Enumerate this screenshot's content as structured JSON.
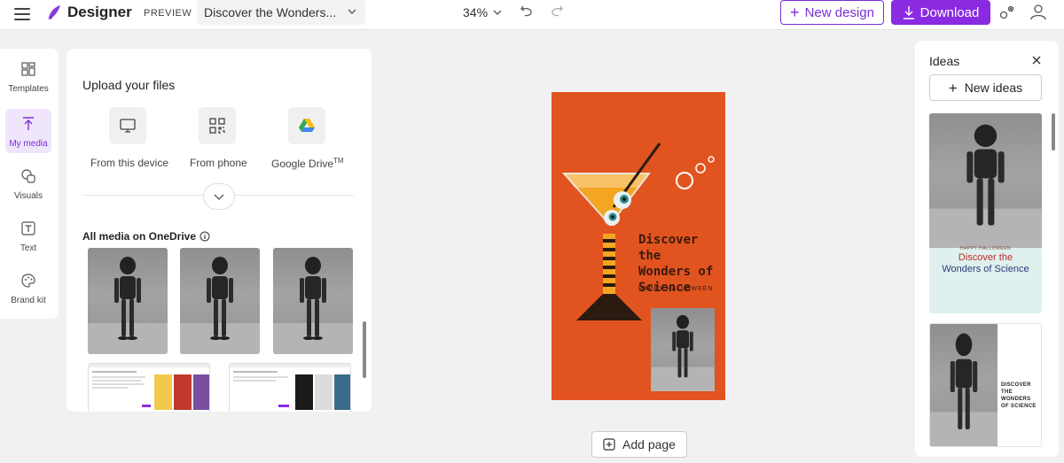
{
  "header": {
    "brand": "Designer",
    "preview_label": "PREVIEW",
    "doc_title": "Discover the Wonders...",
    "zoom": "34%",
    "new_design_label": "New design",
    "download_label": "Download"
  },
  "sidebar": {
    "items": [
      {
        "label": "Templates",
        "icon": "templates-icon"
      },
      {
        "label": "My media",
        "icon": "upload-icon",
        "active": true
      },
      {
        "label": "Visuals",
        "icon": "shapes-icon"
      },
      {
        "label": "Text",
        "icon": "text-icon"
      },
      {
        "label": "Brand kit",
        "icon": "palette-icon"
      }
    ]
  },
  "upload": {
    "title": "Upload your files",
    "sources": [
      {
        "label": "From this device",
        "icon": "monitor-icon"
      },
      {
        "label": "From phone",
        "icon": "qr-code-icon"
      },
      {
        "label": "Google Drive",
        "sup": "TM",
        "icon": "google-drive-icon"
      }
    ],
    "onedrive_label": "All media on OneDrive"
  },
  "canvas": {
    "headline_lines": [
      "Discover the",
      "Wonders of",
      "Science"
    ],
    "subtitle": "HAPPY HALLOWEEN",
    "add_page_label": "Add page",
    "background_color": "#e1541f"
  },
  "ideas": {
    "title": "Ideas",
    "new_ideas_label": "New ideas",
    "card1_kicker": "HAPPY HALLOWEEN",
    "card1_title_1": "Discover the",
    "card1_title_2": "Wonders of Science",
    "card2_lines": [
      "DISCOVER",
      "THE",
      "WONDERS",
      "OF SCIENCE"
    ]
  },
  "colors": {
    "accent": "#8a2be2",
    "poster_orange": "#e1541f"
  }
}
